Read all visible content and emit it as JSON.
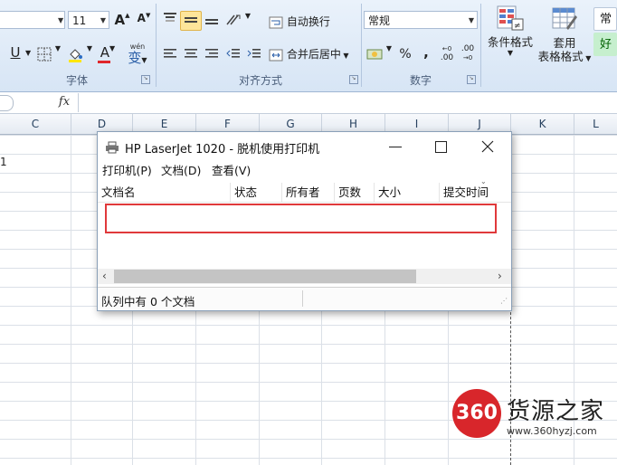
{
  "ribbon": {
    "font_size": "11",
    "grow_font_label": "A",
    "shrink_font_label": "A",
    "underline_label": "U",
    "font_color_label": "A",
    "phonetic_label": "wén",
    "phonetic_char": "变",
    "wrap_text_label": "自动换行",
    "merge_center_label": "合并后居中",
    "number_format": "常规",
    "percent_label": "%",
    "comma_label": ",",
    "inc_decimal_label": ".00",
    "dec_decimal_label": ".00",
    "conditional_format_label": "条件格式",
    "table_format_label_1": "套用",
    "table_format_label_2": "表格格式",
    "style_normal": "常",
    "style_good": "好",
    "group_font": "字体",
    "group_alignment": "对齐方式",
    "group_number": "数字"
  },
  "formula_bar": {
    "fx_label": "fx"
  },
  "sheet": {
    "columns": [
      "C",
      "D",
      "E",
      "F",
      "G",
      "H",
      "I",
      "J",
      "K",
      "L"
    ],
    "row_value": "1"
  },
  "printer_window": {
    "title": "HP LaserJet 1020  -  脱机使用打印机",
    "menus": [
      "打印机(P)",
      "文档(D)",
      "查看(V)"
    ],
    "columns": [
      "文档名",
      "状态",
      "所有者",
      "页数",
      "大小",
      "提交时间"
    ],
    "status_text": "队列中有 0 个文档"
  },
  "watermark": {
    "logo": "360",
    "text": "货源之家",
    "url": "www.360hyzj.com"
  },
  "colors": {
    "highlight_red": "#e0393b",
    "ribbon_bg": "#dce8f6",
    "logo_red": "#d8262b"
  }
}
